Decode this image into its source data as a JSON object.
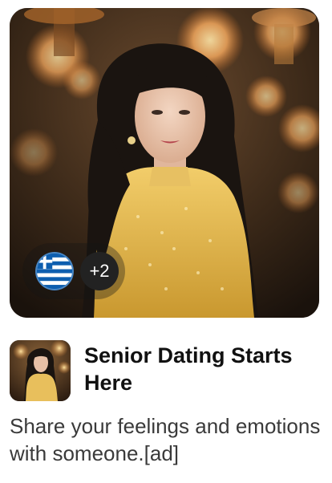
{
  "ad": {
    "image": {
      "subject": "woman-in-gold-dress-photo"
    },
    "flag_chip": {
      "flag_icon": "greece-flag-icon",
      "extra_count": "+2"
    },
    "title": "Senior Dating Starts Here",
    "description": "Share your feelings and emotions with someone.[ad]"
  },
  "colors": {
    "title": "#111111",
    "description": "#3a3a3a",
    "flag_blue": "#0d5eaf",
    "badge_bg": "#222222"
  }
}
